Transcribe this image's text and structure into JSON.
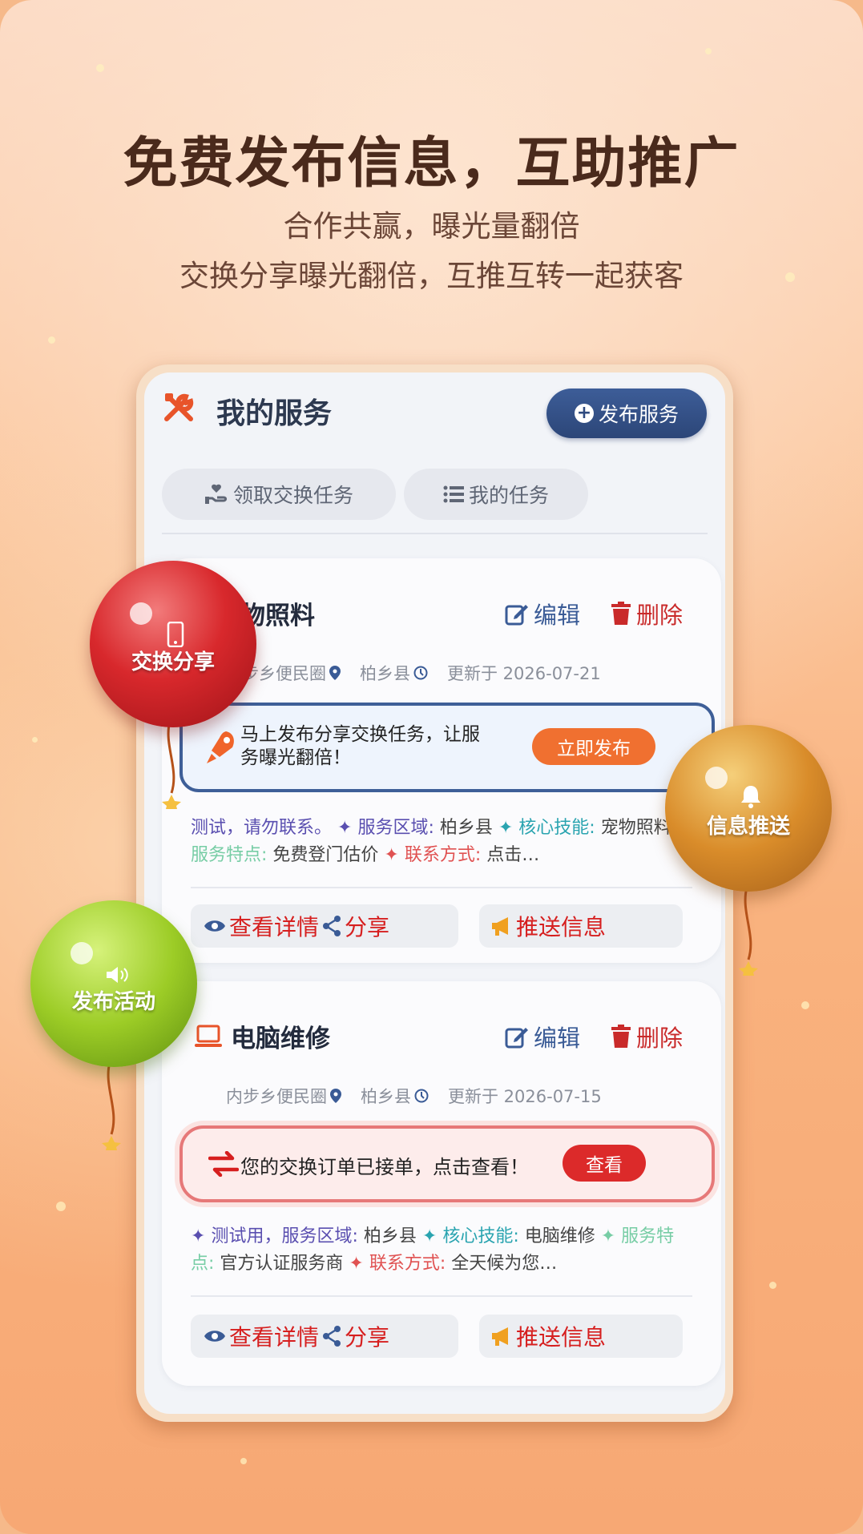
{
  "headline": "免费发布信息，互助推广",
  "subline1": "合作共赢，曝光量翻倍",
  "subline2": "交换分享曝光翻倍，互推互转一起获客",
  "app": {
    "title": "我的服务",
    "publish_button": "发布服务",
    "tabs": [
      {
        "label": "领取交换任务",
        "icon": "hand-heart-icon"
      },
      {
        "label": "我的任务",
        "icon": "list-icon"
      }
    ]
  },
  "cards": [
    {
      "title": "物照料",
      "edit_label": "编辑",
      "delete_label": "删除",
      "circle": "步乡便民圈",
      "county": "柏乡县",
      "updated": "更新于 2026-07-21",
      "notice": {
        "text": "马上发布分享交换任务，让服务曝光翻倍！",
        "button": "立即发布"
      },
      "desc": {
        "intro": "测试，请勿联系。",
        "area_label": "服务区域:",
        "area_value": "柏乡县",
        "skill_label": "核心技能:",
        "skill_value": "宠物照料",
        "feature_label": "服务特点:",
        "feature_value": "免费登门估价",
        "contact_label": "联系方式:",
        "contact_value": "点击…"
      },
      "actions": {
        "detail": "查看详情",
        "share": "分享",
        "push": "推送信息"
      }
    },
    {
      "title": "电脑维修",
      "edit_label": "编辑",
      "delete_label": "删除",
      "circle": "内步乡便民圈",
      "county": "柏乡县",
      "updated": "更新于 2026-07-15",
      "notice": {
        "text": "您的交换订单已接单，点击查看！",
        "button": "查看"
      },
      "desc": {
        "intro": "测试用，",
        "area_label": "服务区域:",
        "area_value": "柏乡县",
        "skill_label": "核心技能:",
        "skill_value": "电脑维修",
        "feature_label": "服务特点:",
        "feature_value": "官方认证服务商",
        "contact_label": "联系方式:",
        "contact_value": "全天候为您…"
      },
      "actions": {
        "detail": "查看详情",
        "share": "分享",
        "push": "推送信息"
      }
    }
  ],
  "balloons": [
    {
      "label": "交换分享",
      "color": "#d8282c",
      "icon": "phone-icon"
    },
    {
      "label": "信息推送",
      "color": "#d98c2a",
      "icon": "bell-icon"
    },
    {
      "label": "发布活动",
      "color": "#9ccc26",
      "icon": "speaker-icon"
    }
  ],
  "colors": {
    "accent_blue": "#2e4a7f",
    "accent_red": "#d61f1f",
    "accent_orange": "#f07030"
  }
}
